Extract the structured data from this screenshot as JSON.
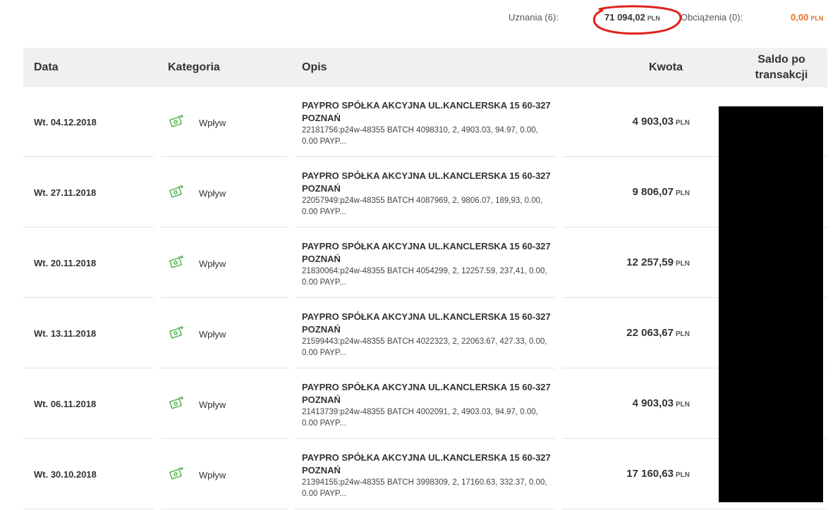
{
  "summary": {
    "credits_label": "Uznania (6):",
    "credits_value": "71 094,02",
    "credits_currency": "PLN",
    "debits_label": "Obciążenia (0):",
    "debits_value": "0,00",
    "debits_currency": "PLN",
    "debits_color": "#e8712a"
  },
  "table": {
    "headers": {
      "date": "Data",
      "category": "Kategoria",
      "description": "Opis",
      "amount": "Kwota",
      "balance_line1": "Saldo po",
      "balance_line2": "transakcji"
    },
    "rows": [
      {
        "date": "Wt. 04.12.2018",
        "category": "Wpływ",
        "category_icon": "money-income-icon",
        "title": "PAYPRO SPÓŁKA AKCYJNA UL.KANCLERSKA 15 60-327 POZNAŃ",
        "details": "22181756:p24w-48355 BATCH 4098310, 2, 4903.03, 94.97, 0.00, 0.00 PAYP...",
        "amount": "4 903,03",
        "currency": "PLN"
      },
      {
        "date": "Wt. 27.11.2018",
        "category": "Wpływ",
        "category_icon": "money-income-icon",
        "title": "PAYPRO SPÓŁKA AKCYJNA UL.KANCLERSKA 15 60-327 POZNAŃ",
        "details": "22057949:p24w-48355 BATCH 4087969, 2, 9806.07, 189,93, 0.00, 0.00 PAYP...",
        "amount": "9 806,07",
        "currency": "PLN"
      },
      {
        "date": "Wt. 20.11.2018",
        "category": "Wpływ",
        "category_icon": "money-income-icon",
        "title": "PAYPRO SPÓŁKA AKCYJNA UL.KANCLERSKA 15 60-327 POZNAŃ",
        "details": "21830064:p24w-48355 BATCH 4054299, 2, 12257.59, 237,41, 0.00, 0.00 PAYP...",
        "amount": "12 257,59",
        "currency": "PLN"
      },
      {
        "date": "Wt. 13.11.2018",
        "category": "Wpływ",
        "category_icon": "money-income-icon",
        "title": "PAYPRO SPÓŁKA AKCYJNA UL.KANCLERSKA 15 60-327 POZNAŃ",
        "details": "21599443:p24w-48355 BATCH 4022323, 2, 22063.67, 427.33, 0.00, 0.00 PAYP...",
        "amount": "22 063,67",
        "currency": "PLN"
      },
      {
        "date": "Wt. 06.11.2018",
        "category": "Wpływ",
        "category_icon": "money-income-icon",
        "title": "PAYPRO SPÓŁKA AKCYJNA UL.KANCLERSKA 15 60-327 POZNAŃ",
        "details": "21413739:p24w-48355 BATCH 4002091, 2, 4903.03, 94.97, 0.00, 0.00 PAYP...",
        "amount": "4 903,03",
        "currency": "PLN"
      },
      {
        "date": "Wt. 30.10.2018",
        "category": "Wpływ",
        "category_icon": "money-income-icon",
        "title": "PAYPRO SPÓŁKA AKCYJNA UL.KANCLERSKA 15 60-327 POZNAŃ",
        "details": "21394155:p24w-48355 BATCH 3998309, 2, 17160.63, 332.37, 0.00, 0.00 PAYP...",
        "amount": "17 160,63",
        "currency": "PLN"
      }
    ]
  },
  "colors": {
    "icon_green": "#5cb85c",
    "header_bg": "#f0f0f0",
    "annotation_red": "#e0201b"
  }
}
